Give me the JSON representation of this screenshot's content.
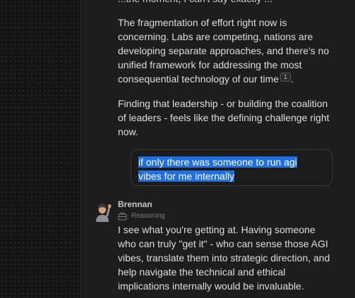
{
  "conversation": {
    "cutoff_line": "...the moment, I can't say exactly ...",
    "paragraph_1": "The fragmentation of effort right now is concerning. Labs are competing, nations are developing separate approaches, and there's no unified framework for addressing the most consequential technology of our time",
    "paragraph_1_footnote": "1",
    "paragraph_1_end": ".",
    "paragraph_2": "Finding that leadership - or building the coalition of leaders - feels like the defining challenge right now.",
    "user_message": "if only there was someone to run agi vibes for me internally",
    "reply": {
      "sender": "Brennan",
      "reasoning_label": "Reasoning",
      "avatar_icon": "person-raising-hand-emoji",
      "text": "I see what you're getting at. Having someone who can truly \"get it\" - who can sense those AGI vibes, translate them into strategic direction, and help navigate the technical and ethical implications internally would be invaluable."
    }
  },
  "colors": {
    "sidebar_bg": "#141414",
    "chat_bg": "#1d1d1e",
    "selection": "#1f6fe0",
    "text": "#dedede"
  }
}
